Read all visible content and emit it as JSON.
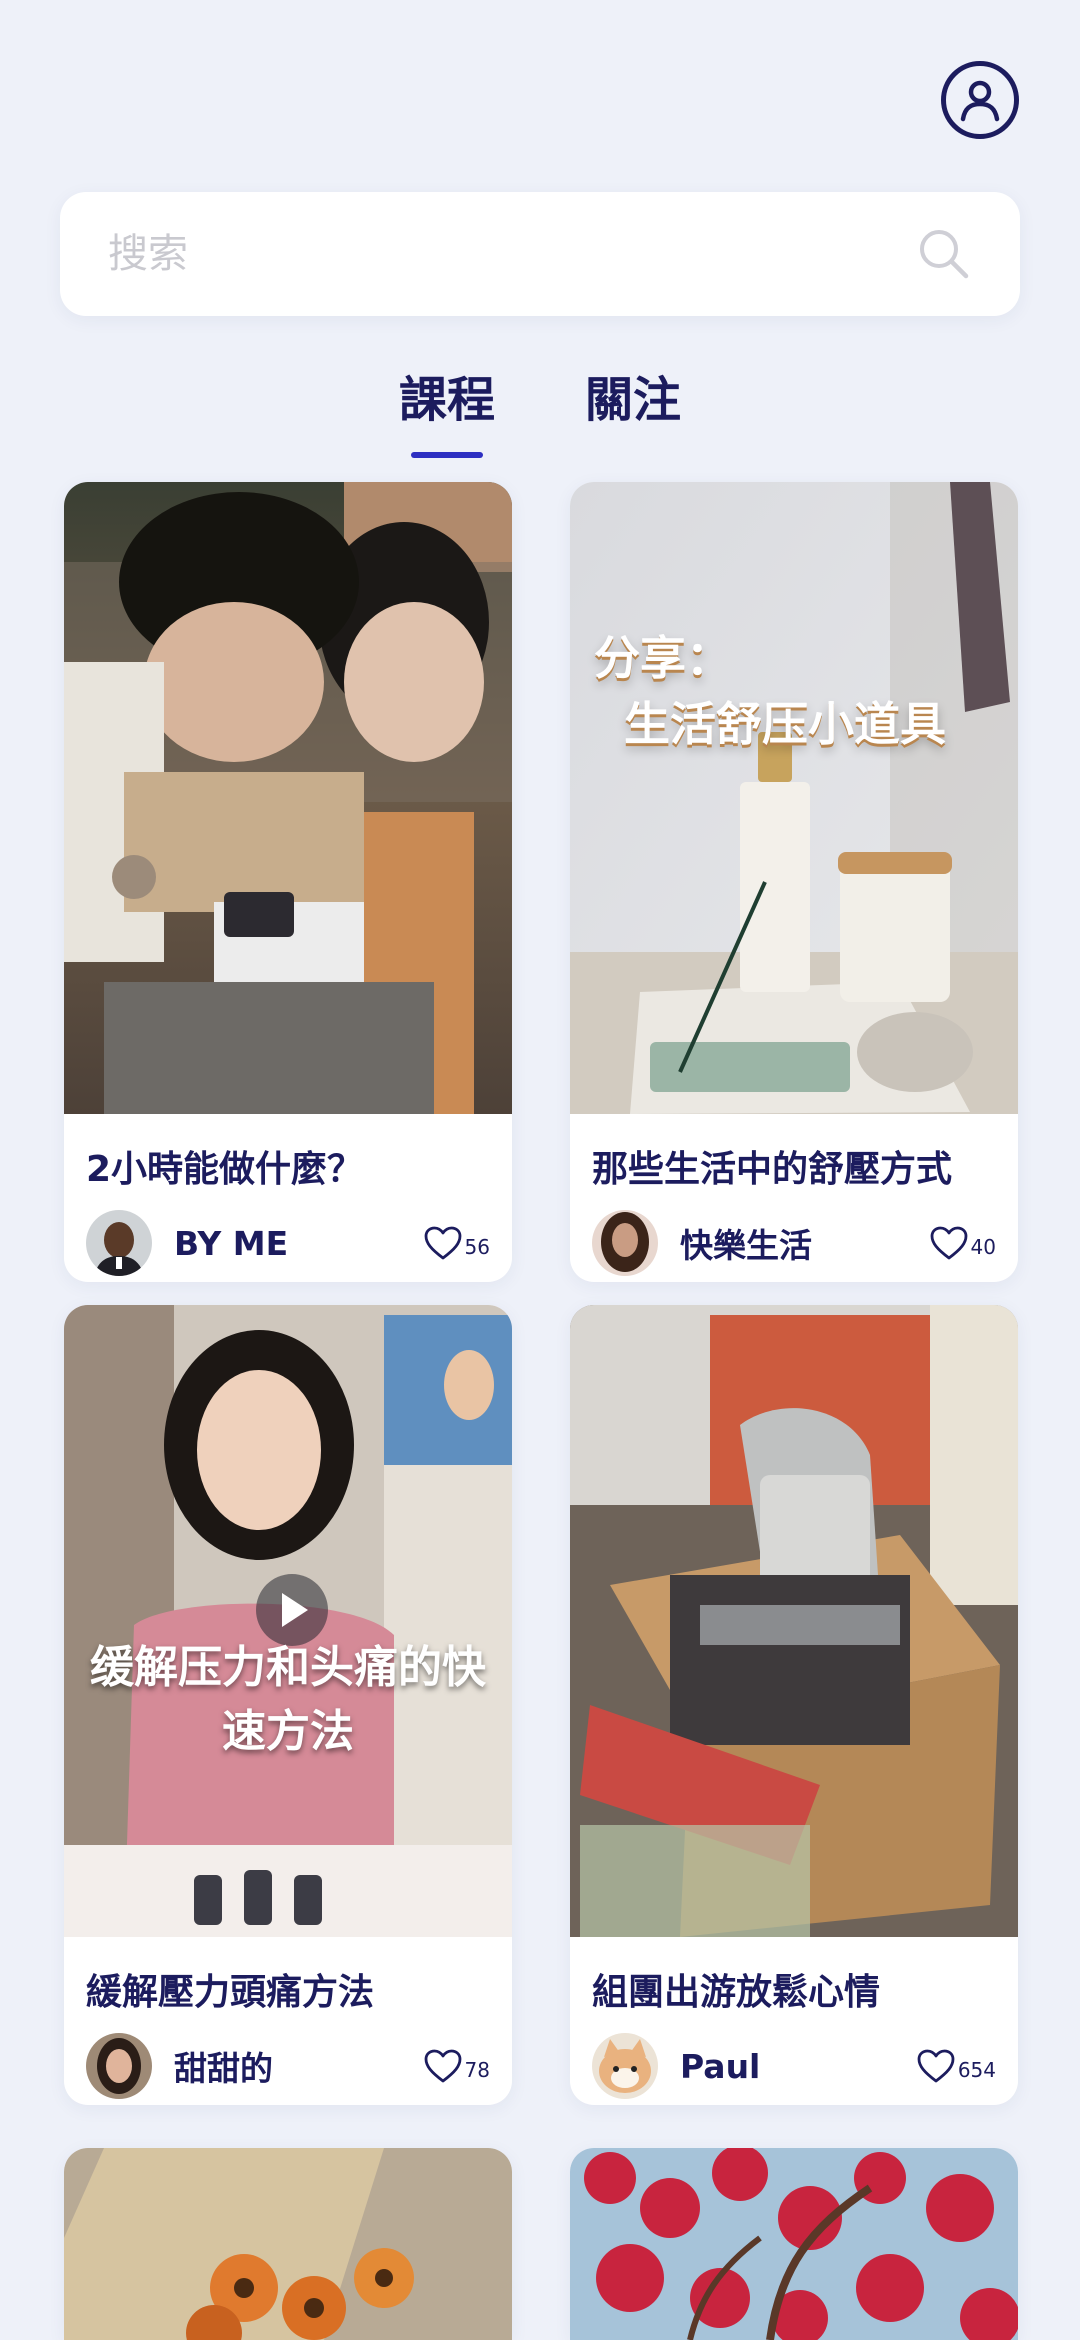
{
  "search": {
    "placeholder": "搜索"
  },
  "tabs": [
    {
      "label": "課程",
      "active": true
    },
    {
      "label": "關注",
      "active": false
    }
  ],
  "cards": [
    {
      "title": "2小時能做什麼？",
      "author": "BY ME",
      "likes": "56"
    },
    {
      "title": "那些生活中的舒壓方式",
      "author": "快樂生活",
      "likes": "40",
      "overlay": [
        "分享：",
        "生活舒压小道具"
      ]
    },
    {
      "title": "緩解壓力頭痛方法",
      "author": "甜甜的",
      "likes": "78",
      "overlay": [
        "缓解压力和头痛的快",
        "速方法"
      ]
    },
    {
      "title": "組團出游放鬆心情",
      "author": "Paul",
      "likes": "654"
    }
  ],
  "colors": {
    "background": "#eef1f9",
    "primary": "#1c1c5e",
    "accent": "#2d2fc2"
  },
  "icons": {
    "profile": "user-circle-icon",
    "search": "search-icon",
    "like": "heart-icon",
    "play": "play-icon"
  }
}
